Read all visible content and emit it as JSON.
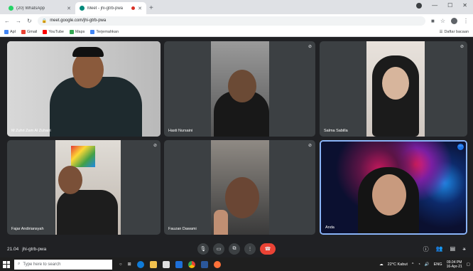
{
  "browser": {
    "tabs": [
      {
        "title": "(20) WhatsApp",
        "color": "#25d366",
        "active": false
      },
      {
        "title": "Meet - jhi-gtrb-pwa",
        "color": "#00897b",
        "active": true
      }
    ],
    "url": "meet.google.com/jhi-gtrb-pwa",
    "bookmarks": [
      {
        "label": "Apl",
        "color": "#4285f4"
      },
      {
        "label": "Gmail",
        "color": "#ea4335"
      },
      {
        "label": "YouTube",
        "color": "#ff0000"
      },
      {
        "label": "Maps",
        "color": "#34a853"
      },
      {
        "label": "Terjemahkan",
        "color": "#4285f4"
      }
    ],
    "reading_list": "Daftar bacaan"
  },
  "participants": [
    {
      "name": "M Zuhri Zam Al Zuhairi",
      "muted": false
    },
    {
      "name": "Hasti Nursaini",
      "muted": true
    },
    {
      "name": "Salma Sabilla",
      "muted": true
    },
    {
      "name": "Fajar Andiriansyah",
      "muted": true
    },
    {
      "name": "Fauzan Dawami",
      "muted": true
    },
    {
      "name": "Anda",
      "muted": false
    }
  ],
  "meet": {
    "time": "21.04",
    "code": "jhi-gtrb-pwa"
  },
  "taskbar": {
    "search_placeholder": "Type here to search",
    "weather": "22°C Kabut",
    "lang": "ENG",
    "time": "09.04 PM",
    "date": "16-Apr-21"
  }
}
